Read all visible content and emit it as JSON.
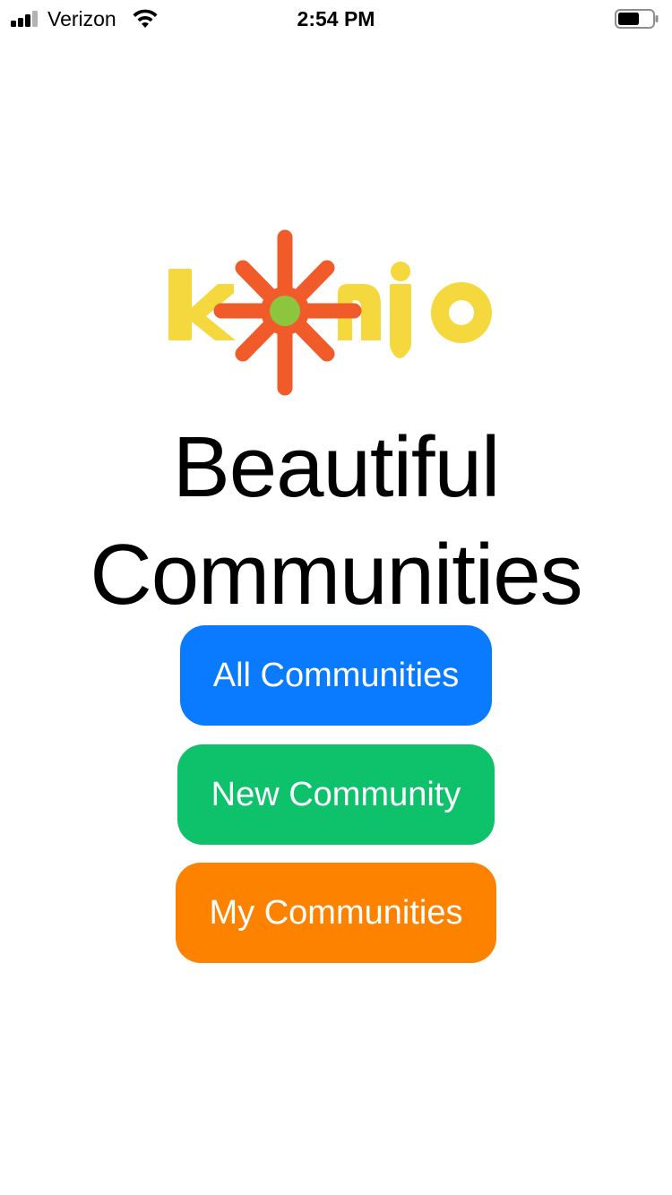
{
  "status_bar": {
    "carrier": "Verizon",
    "time": "2:54 PM",
    "signal_bars_filled": 3,
    "signal_bars_total": 4,
    "battery_level": 0.6,
    "icons": [
      "signal-icon",
      "wifi-icon",
      "battery-icon"
    ]
  },
  "logo": {
    "text": "konjo",
    "colors": {
      "letters": "#f5d83d",
      "star": "#f15a29",
      "center": "#8cc63f"
    }
  },
  "headline": {
    "line1": "Beautiful",
    "line2": "Communities"
  },
  "buttons": {
    "all_communities": {
      "label": "All Communities",
      "color": "#0a7aff"
    },
    "new_community": {
      "label": "New Community",
      "color": "#0ec26b"
    },
    "my_communities": {
      "label": "My Communities",
      "color": "#fd8200"
    }
  }
}
